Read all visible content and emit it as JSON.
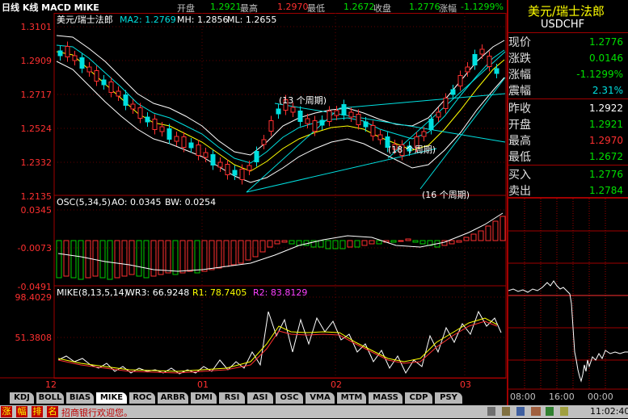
{
  "topbar": {
    "chart_label": "日线 K线 MACD MIKE",
    "open_label": "开盘",
    "open_value": "1.2921",
    "high_label": "最高",
    "high_value": "1.2970",
    "low_label": "最低",
    "low_value": "1.2672",
    "close_label": "收盘",
    "close_value": "1.2776",
    "change_label": "涨幅",
    "change_value": "-1.1299%"
  },
  "main_panel": {
    "indicator_text": "美元/瑞士法郎",
    "ma_text": "MA2: 1.2769",
    "mh_text": "MH: 1.2856",
    "ml_text": "ML: 1.2655",
    "y_ticks": [
      "1.3101",
      "1.2909",
      "1.2717",
      "1.2524",
      "1.2332",
      "1.2135"
    ],
    "annotations": [
      "(13 个周期)",
      "(18 个周期)",
      "(16 个周期)"
    ]
  },
  "osc_panel": {
    "header_osc": "OSC(5,34,5)",
    "header_ao": "AO: 0.0345",
    "header_bw": "BW: 0.0254",
    "y_ticks": [
      "0.0345",
      "-0.0073",
      "-0.0491"
    ]
  },
  "mike_panel": {
    "header_mike": "MIKE(8,13,5,14)",
    "header_wr": "WR3: 66.9248",
    "header_r1": "R1: 78.7405",
    "header_r2": "R2: 83.8129",
    "y_ticks": [
      "98.4029",
      "51.3808"
    ]
  },
  "x_axis": [
    "12",
    "01",
    "02",
    "03"
  ],
  "tabs": [
    "KDJ",
    "BOLL",
    "BIAS",
    "MIKE",
    "ROC",
    "ARBR",
    "DMI",
    "RSI",
    "ASI",
    "OSC",
    "VMA",
    "MTM",
    "MASS",
    "CDP",
    "PSY"
  ],
  "active_tab": "MIKE",
  "quote": {
    "title": "美元/瑞士法郎",
    "symbol": "USDCHF",
    "rows": [
      {
        "label": "现价",
        "value": "1.2776"
      },
      {
        "label": "涨跌",
        "value": "0.0146"
      },
      {
        "label": "涨幅",
        "value": "-1.1299%"
      },
      {
        "label": "震幅",
        "value": "2.31%"
      },
      {
        "label": "昨收",
        "value": "1.2922"
      },
      {
        "label": "开盘",
        "value": "1.2921"
      },
      {
        "label": "最高",
        "value": "1.2970"
      },
      {
        "label": "最低",
        "value": "1.2672"
      },
      {
        "label": "买入",
        "value": "1.2776"
      },
      {
        "label": "卖出",
        "value": "1.2784"
      }
    ]
  },
  "intraday": {
    "time_labels": [
      "08:00",
      "16:00",
      "00:00"
    ]
  },
  "statusbar": {
    "tiles": [
      "涨",
      "幅",
      "排",
      "名"
    ],
    "ticker": "招商银行欢迎您。",
    "clock": "11:02:40"
  },
  "colors": {
    "up": "#ff3030",
    "down": "#00e0e0",
    "frame": "#a00000",
    "neutral": "#c0c0c0"
  }
}
